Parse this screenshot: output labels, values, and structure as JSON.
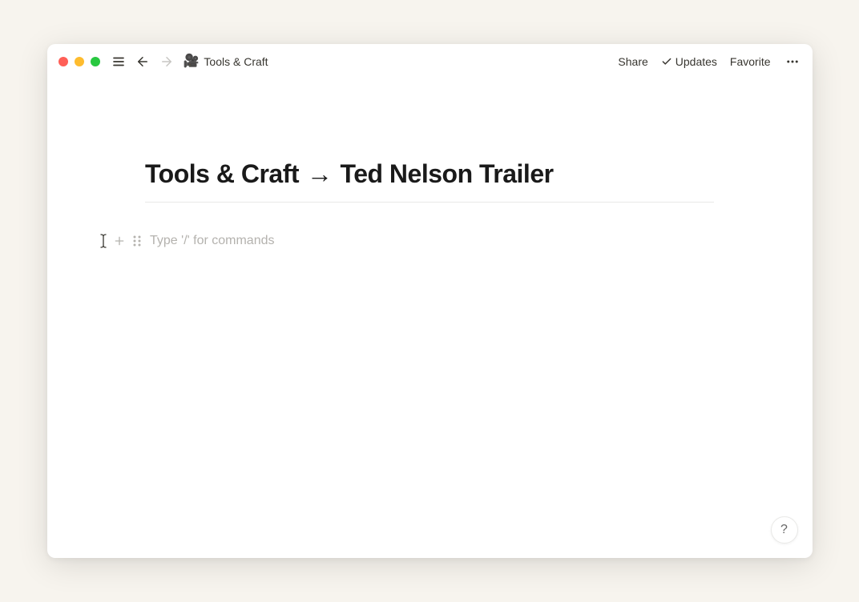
{
  "topbar": {
    "breadcrumb_icon": "🎥",
    "breadcrumb_text": "Tools & Craft",
    "share_label": "Share",
    "updates_label": "Updates",
    "favorite_label": "Favorite"
  },
  "page": {
    "title_part1": "Tools & Craft",
    "title_arrow": "→",
    "title_part2": "Ted Nelson Trailer"
  },
  "editor": {
    "placeholder": "Type '/' for commands"
  },
  "help": {
    "label": "?"
  }
}
